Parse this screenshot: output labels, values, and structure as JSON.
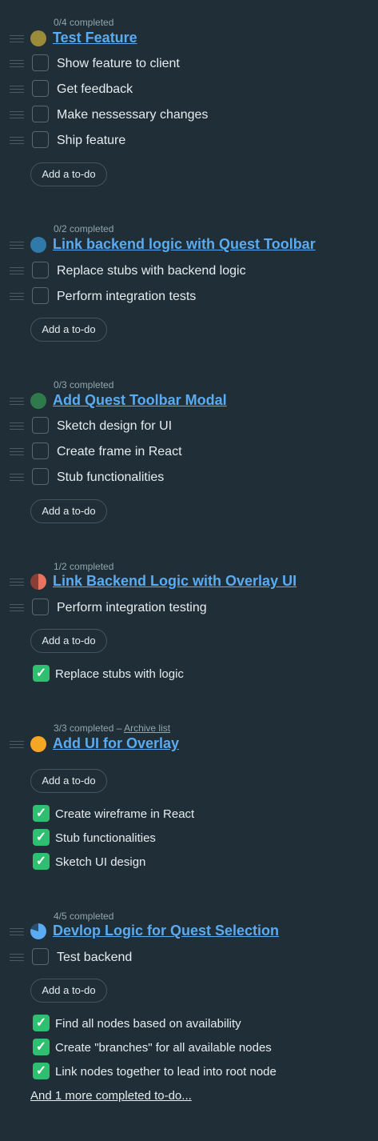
{
  "lists": [
    {
      "completed_label": "0/4 completed",
      "title": "Test Feature",
      "progress": 0,
      "color": "#9a8a3a",
      "todos": [
        "Show feature to client",
        "Get feedback",
        "Make nessessary changes",
        "Ship feature"
      ],
      "add_label": "Add a to-do",
      "done": []
    },
    {
      "completed_label": "0/2 completed",
      "title": "Link backend logic with Quest Toolbar",
      "progress": 0,
      "color": "#2f7aa8",
      "todos": [
        "Replace stubs with backend logic",
        "Perform integration tests"
      ],
      "add_label": "Add a to-do",
      "done": []
    },
    {
      "completed_label": "0/3 completed",
      "title": "Add Quest Toolbar Modal",
      "progress": 0,
      "color": "#2e7a4a",
      "todos": [
        "Sketch design for UI",
        "Create frame in React",
        "Stub functionalities"
      ],
      "add_label": "Add a to-do",
      "done": []
    },
    {
      "completed_label": "1/2 completed",
      "title": "Link Backend Logic with Overlay UI",
      "progress": 0.5,
      "color": "#e8735f",
      "todos": [
        "Perform integration testing"
      ],
      "add_label": "Add a to-do",
      "done": [
        "Replace stubs with logic"
      ]
    },
    {
      "completed_label": "3/3 completed –",
      "archive_label": "Archive list",
      "title": "Add UI for Overlay",
      "progress": 1,
      "color": "#f5a623",
      "todos": [],
      "add_label": "Add a to-do",
      "done": [
        "Create wireframe in React",
        "Stub functionalities",
        "Sketch UI design"
      ]
    },
    {
      "completed_label": "4/5 completed",
      "title": "Devlop Logic for Quest Selection",
      "progress": 0.8,
      "color": "#5aabf1",
      "todos": [
        "Test backend"
      ],
      "add_label": "Add a to-do",
      "done": [
        "Find all nodes based on availability",
        "Create \"branches\" for all available nodes",
        "Link nodes together to lead into root node"
      ],
      "more_label": "And 1 more completed to-do..."
    }
  ]
}
